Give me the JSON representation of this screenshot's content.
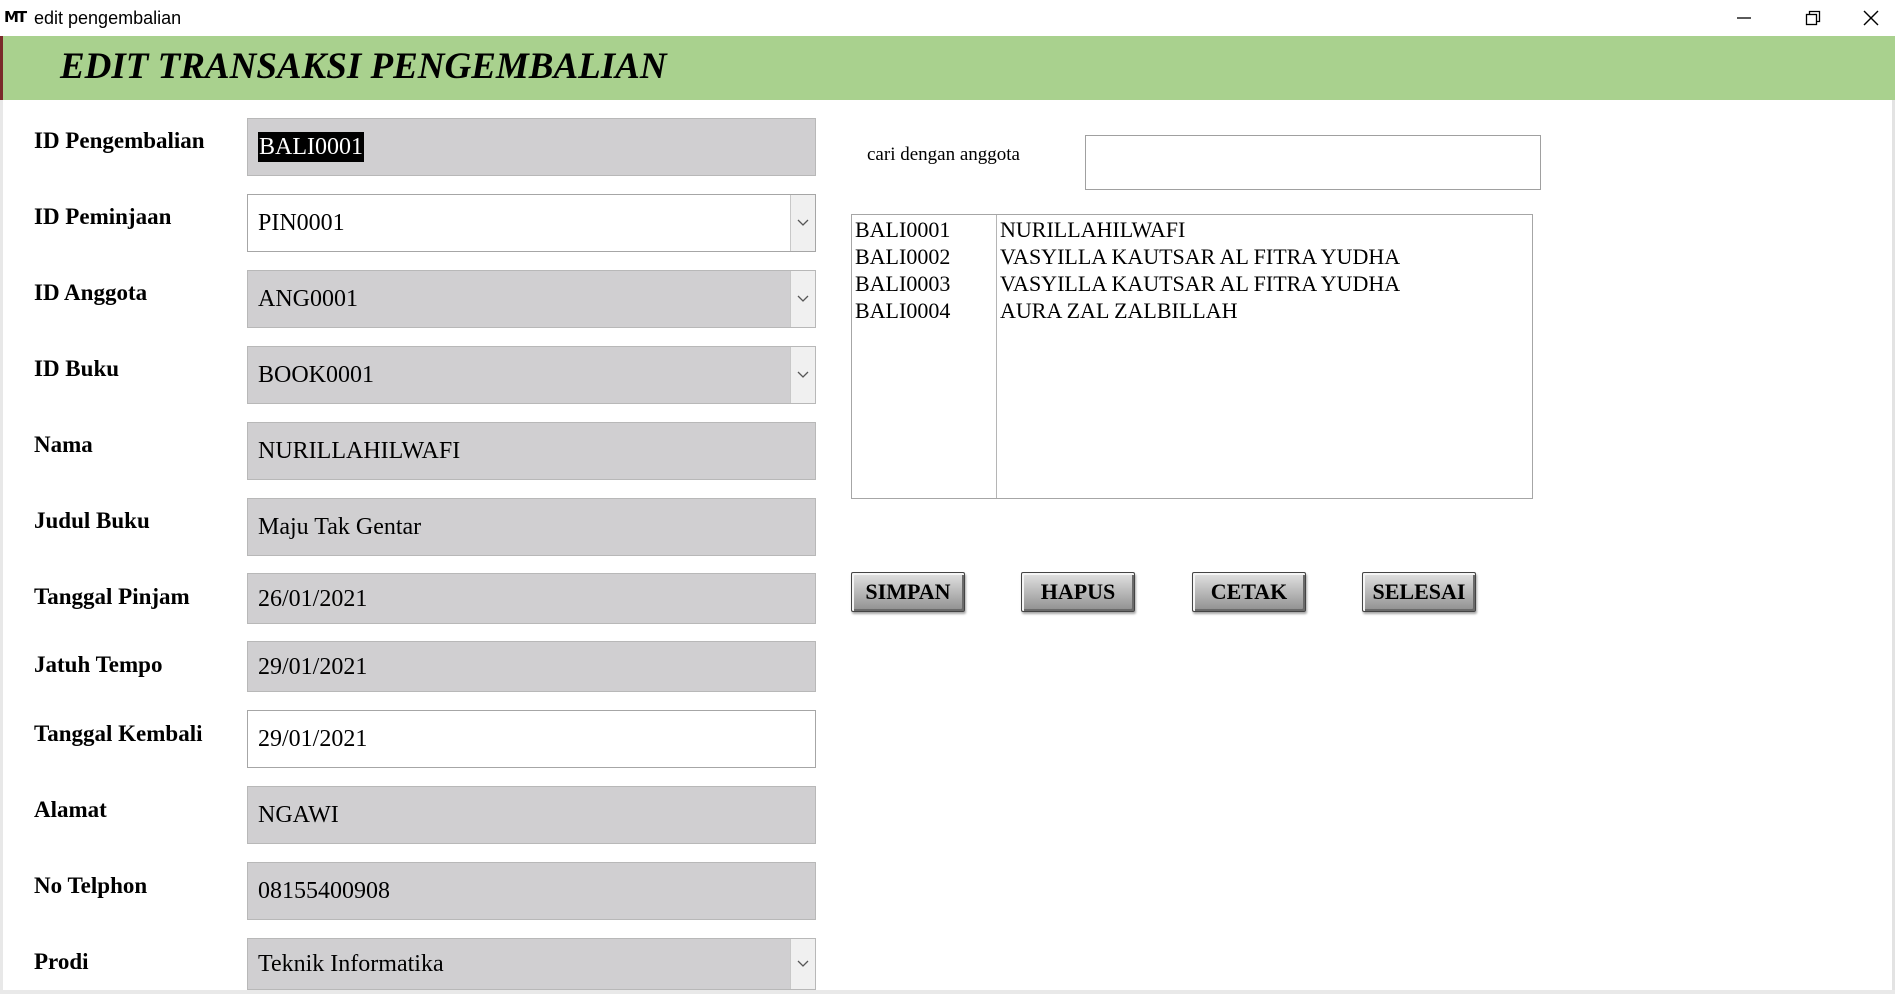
{
  "window": {
    "title": "edit pengembalian",
    "icon_label": "MT"
  },
  "header": {
    "title": "EDIT TRANSAKSI PENGEMBALIAN",
    "background_color": "#a9d18e"
  },
  "form": {
    "fields": [
      {
        "label": "ID Pengembalian",
        "value": "BALI0001"
      },
      {
        "label": "ID Peminjaan",
        "value": "PIN0001"
      },
      {
        "label": "ID Anggota",
        "value": "ANG0001"
      },
      {
        "label": "ID Buku",
        "value": "BOOK0001"
      },
      {
        "label": "Nama",
        "value": "NURILLAHILWAFI"
      },
      {
        "label": "Judul Buku",
        "value": "Maju Tak Gentar"
      },
      {
        "label": "Tanggal Pinjam",
        "value": "26/01/2021"
      },
      {
        "label": "Jatuh Tempo",
        "value": "29/01/2021"
      },
      {
        "label": "Tanggal Kembali",
        "value": "29/01/2021"
      },
      {
        "label": "Alamat",
        "value": "NGAWI"
      },
      {
        "label": "No Telphon",
        "value": "08155400908"
      },
      {
        "label": "Prodi",
        "value": "Teknik Informatika"
      }
    ]
  },
  "search": {
    "label": "cari dengan anggota",
    "value": ""
  },
  "list": {
    "rows": [
      {
        "id": "BALI0001",
        "name": "NURILLAHILWAFI"
      },
      {
        "id": "BALI0002",
        "name": "VASYILLA KAUTSAR AL FITRA YUDHA"
      },
      {
        "id": "BALI0003",
        "name": "VASYILLA KAUTSAR AL FITRA YUDHA"
      },
      {
        "id": "BALI0004",
        "name": "AURA ZAL ZALBILLAH"
      }
    ]
  },
  "buttons": {
    "save": "SIMPAN",
    "delete": "HAPUS",
    "print": "CETAK",
    "finish": "SELESAI"
  }
}
